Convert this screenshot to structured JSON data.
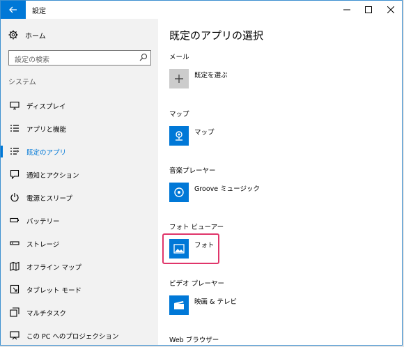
{
  "window": {
    "title": "設定"
  },
  "sidebar": {
    "home_label": "ホーム",
    "search_placeholder": "設定の検索",
    "section_header": "システム",
    "items": [
      {
        "label": "ディスプレイ",
        "icon": "monitor-icon",
        "active": false
      },
      {
        "label": "アプリと機能",
        "icon": "list-icon",
        "active": false
      },
      {
        "label": "既定のアプリ",
        "icon": "default-apps-icon",
        "active": true
      },
      {
        "label": "通知とアクション",
        "icon": "notification-icon",
        "active": false
      },
      {
        "label": "電源とスリープ",
        "icon": "power-icon",
        "active": false
      },
      {
        "label": "バッテリー",
        "icon": "battery-icon",
        "active": false
      },
      {
        "label": "ストレージ",
        "icon": "storage-icon",
        "active": false
      },
      {
        "label": "オフライン マップ",
        "icon": "map-icon",
        "active": false
      },
      {
        "label": "タブレット モード",
        "icon": "tablet-icon",
        "active": false
      },
      {
        "label": "マルチタスク",
        "icon": "multitask-icon",
        "active": false
      },
      {
        "label": "この PC へのプロジェクション",
        "icon": "projection-icon",
        "active": false
      }
    ]
  },
  "main": {
    "title": "既定のアプリの選択",
    "categories": [
      {
        "label": "メール",
        "app": "既定を選ぶ",
        "icon": "plus-icon"
      },
      {
        "label": "マップ",
        "app": "マップ",
        "icon": "maps-app-icon"
      },
      {
        "label": "音楽プレーヤー",
        "app": "Groove ミュージック",
        "icon": "groove-icon"
      },
      {
        "label": "フォト ビューアー",
        "app": "フォト",
        "icon": "photos-icon"
      },
      {
        "label": "ビデオ プレーヤー",
        "app": "映画 & テレビ",
        "icon": "movies-icon"
      },
      {
        "label": "Web ブラウザー",
        "app": "",
        "icon": ""
      }
    ]
  },
  "colors": {
    "accent": "#0078d7",
    "highlight": "#e0356a"
  }
}
